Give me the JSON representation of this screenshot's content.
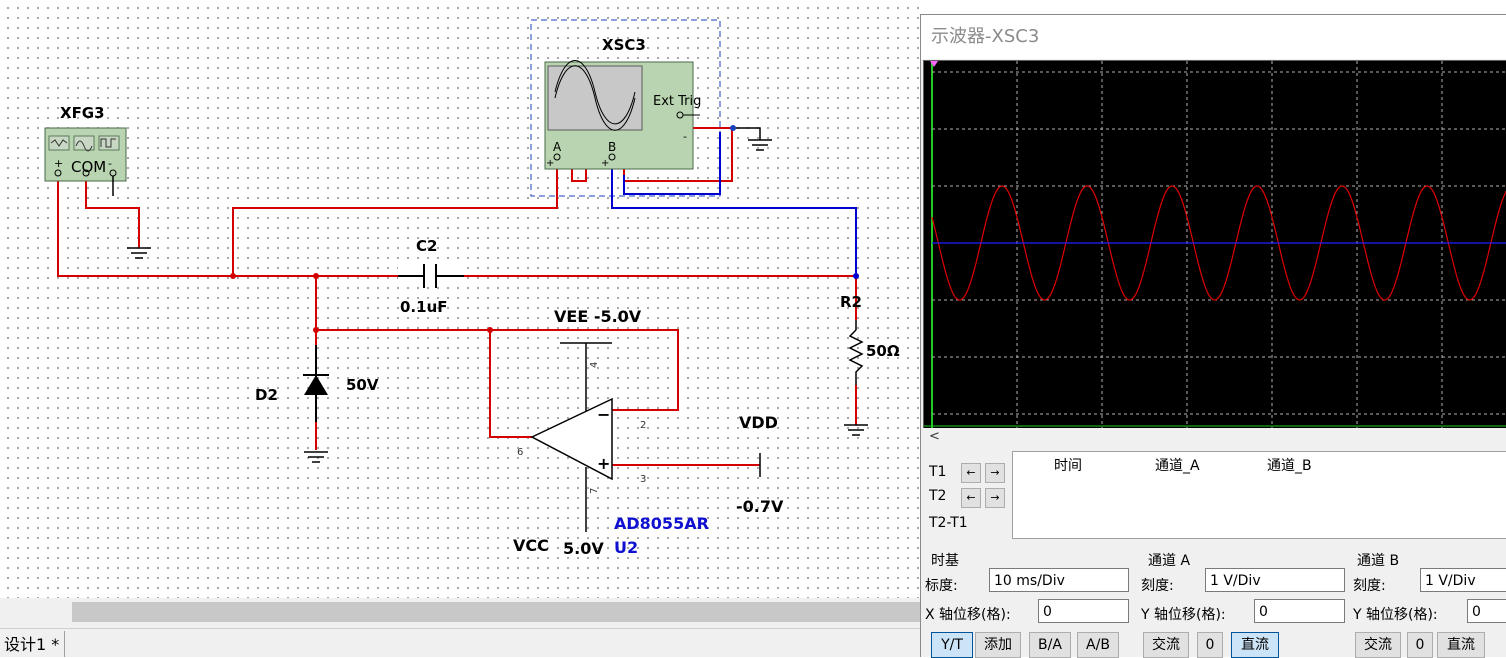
{
  "schematic": {
    "function_generator": {
      "name": "XFG3",
      "com_label": "COM",
      "plus": "+",
      "minus": "-"
    },
    "oscilloscope": {
      "name": "XSC3",
      "ext_trig": "Ext Trig",
      "ch_a": "A",
      "ch_b": "B",
      "plus": "+",
      "minus": "-"
    },
    "capacitor": {
      "ref": "C2",
      "value": "0.1uF"
    },
    "resistor": {
      "ref": "R2",
      "value": "50Ω"
    },
    "diode": {
      "ref": "D2",
      "value": "50V"
    },
    "opamp": {
      "part": "AD8055AR",
      "ref": "U2",
      "pin2": "2",
      "pin3": "3",
      "pin4": "4",
      "pin6": "6",
      "pin7": "7"
    },
    "vee": "VEE -5.0V",
    "vdd": "VDD",
    "vdd_value": "-0.7V",
    "vcc": "VCC",
    "vcc_value": "5.0V"
  },
  "statusbar": {
    "tab": "设计1 *"
  },
  "scope_window": {
    "title": "示波器-XSC3",
    "scroll_left": "<",
    "cursors": {
      "t1": "T1",
      "t2": "T2",
      "t2_t1": "T2-T1",
      "left": "←",
      "right": "→"
    },
    "readout_headers": [
      "时间",
      "通道_A",
      "通道_B"
    ],
    "timebase": {
      "group": "时基",
      "scale_label": "标度:",
      "scale": "10 ms/Div",
      "xpos_label": "X 轴位移(格):",
      "xpos": "0"
    },
    "channel_a": {
      "group": "通道 A",
      "scale_label": "刻度:",
      "scale": "1  V/Div",
      "ypos_label": "Y 轴位移(格):",
      "ypos": "0"
    },
    "channel_b": {
      "group": "通道 B",
      "scale_label": "刻度:",
      "scale": "1  V/Div",
      "ypos_label": "Y 轴位移(格):",
      "ypos": "0"
    },
    "mode_buttons": [
      "Y/T",
      "添加",
      "B/A",
      "A/B"
    ],
    "coupling_a": [
      "交流",
      "0",
      "直流"
    ],
    "coupling_b": [
      "交流",
      "0",
      "直流"
    ]
  },
  "colors": {
    "wire_red": "#d40000",
    "wire_blue": "#0000d0",
    "trace_a": "#e00000",
    "trace_b": "#2020ff",
    "grid": "#b0b0b0"
  },
  "screen_trace": {
    "channel_a_period_div": 1.0,
    "channel_a_amplitude_div": 1.0,
    "channel_b_level_div": 0
  }
}
